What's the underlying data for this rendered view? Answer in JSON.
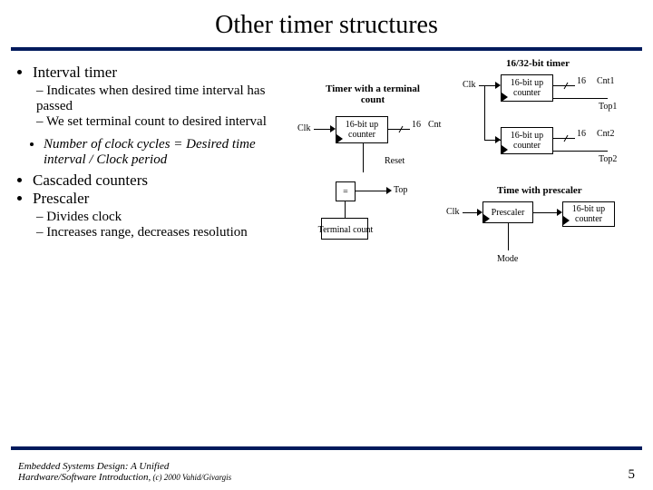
{
  "title": "Other timer structures",
  "bullets": {
    "l1a": "Interval timer",
    "l2a": "Indicates when desired time interval has passed",
    "l2b": "We set terminal count to desired interval",
    "l3a": "Number of clock cycles = Desired time interval / Clock period",
    "l1b": "Cascaded counters",
    "l1c": "Prescaler",
    "l2c": "Divides clock",
    "l2d": "Increases range, decreases resolution"
  },
  "diagram": {
    "sect1_title": "16/32-bit timer",
    "sect2_title": "Timer with a terminal count",
    "sect3_title": "Time with prescaler",
    "clk": "Clk",
    "counter16": "16-bit up counter",
    "equals": "=",
    "reset": "Reset",
    "top": "Top",
    "terminal_count": "Terminal count",
    "prescaler": "Prescaler",
    "mode": "Mode",
    "sixteen": "16",
    "cnt": "Cnt",
    "cnt1": "Cnt1",
    "cnt2": "Cnt2",
    "top1": "Top1",
    "top2": "Top2"
  },
  "footer": {
    "credit1": "Embedded Systems Design: A Unified",
    "credit2": "Hardware/Software Introduction,",
    "credit3": " (c) 2000 Vahid/Givargis",
    "page": "5"
  }
}
